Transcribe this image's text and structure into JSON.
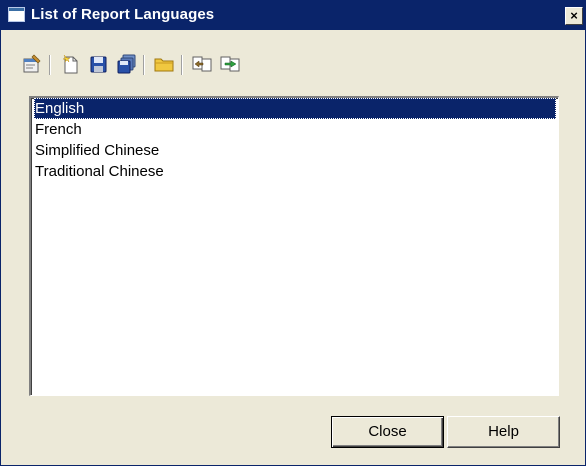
{
  "window": {
    "title": "List of Report Languages",
    "close_glyph": "×"
  },
  "toolbar": {
    "buttons": [
      {
        "name": "properties-icon",
        "tooltip": ""
      },
      {
        "name": "new-icon",
        "tooltip": ""
      },
      {
        "name": "save-icon",
        "tooltip": ""
      },
      {
        "name": "save-all-icon",
        "tooltip": ""
      },
      {
        "name": "open-folder-icon",
        "tooltip": ""
      },
      {
        "name": "import-icon",
        "tooltip": ""
      },
      {
        "name": "export-icon",
        "tooltip": ""
      }
    ]
  },
  "languages": {
    "items": [
      "English",
      "French",
      "Simplified Chinese",
      "Traditional Chinese"
    ],
    "selected_index": 0
  },
  "footer": {
    "close_label": "Close",
    "help_label": "Help"
  },
  "colors": {
    "titlebar": "#0a246a",
    "selection": "#0a246a",
    "dialog_face": "#ece9d8"
  }
}
